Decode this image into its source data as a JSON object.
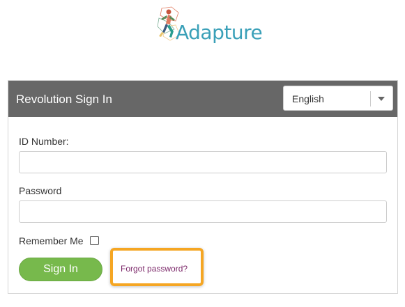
{
  "logo": {
    "text": "Adapture",
    "icon": "runner-logo-icon",
    "text_color": "#3aa0b8"
  },
  "signin": {
    "title": "Revolution Sign In",
    "header_color": "#676767",
    "language": {
      "selected": "English",
      "icon": "chevron-down-icon"
    },
    "id_label": "ID Number:",
    "id_value": "",
    "password_label": "Password",
    "password_value": "",
    "remember_label": "Remember Me",
    "remember_checked": false,
    "submit_label": "Sign In",
    "submit_color": "#77b94c",
    "forgot_label": "Forgot password?",
    "forgot_color": "#7d2a6b",
    "highlight_color": "#f5a623"
  }
}
